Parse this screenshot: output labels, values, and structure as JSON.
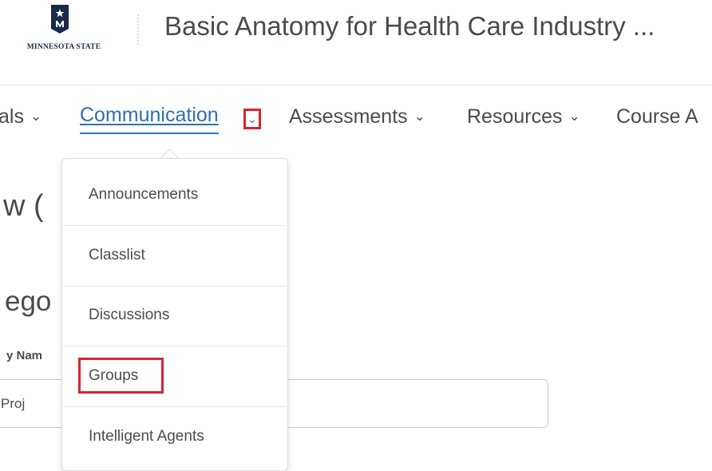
{
  "header": {
    "logo_text": "MINNESOTA STATE",
    "course_title": "Basic Anatomy for Health Care Industry ..."
  },
  "nav": {
    "items": [
      {
        "label": "als"
      },
      {
        "label": "Communication"
      },
      {
        "label": "Assessments"
      },
      {
        "label": "Resources"
      },
      {
        "label": "Course A"
      }
    ]
  },
  "dropdown": {
    "items": [
      {
        "label": "Announcements"
      },
      {
        "label": "Classlist"
      },
      {
        "label": "Discussions"
      },
      {
        "label": "Groups"
      },
      {
        "label": "Intelligent Agents"
      }
    ]
  },
  "page_background": {
    "heading_1": "w (",
    "heading_2": "ego",
    "field_label": "y Nam",
    "field_value": "Proj"
  },
  "colors": {
    "text": "#494c4e",
    "link": "#2f6fb2",
    "highlight": "#d8252f"
  },
  "icons": [
    "minnesota-state-logo-icon",
    "chevron-down-icon"
  ]
}
